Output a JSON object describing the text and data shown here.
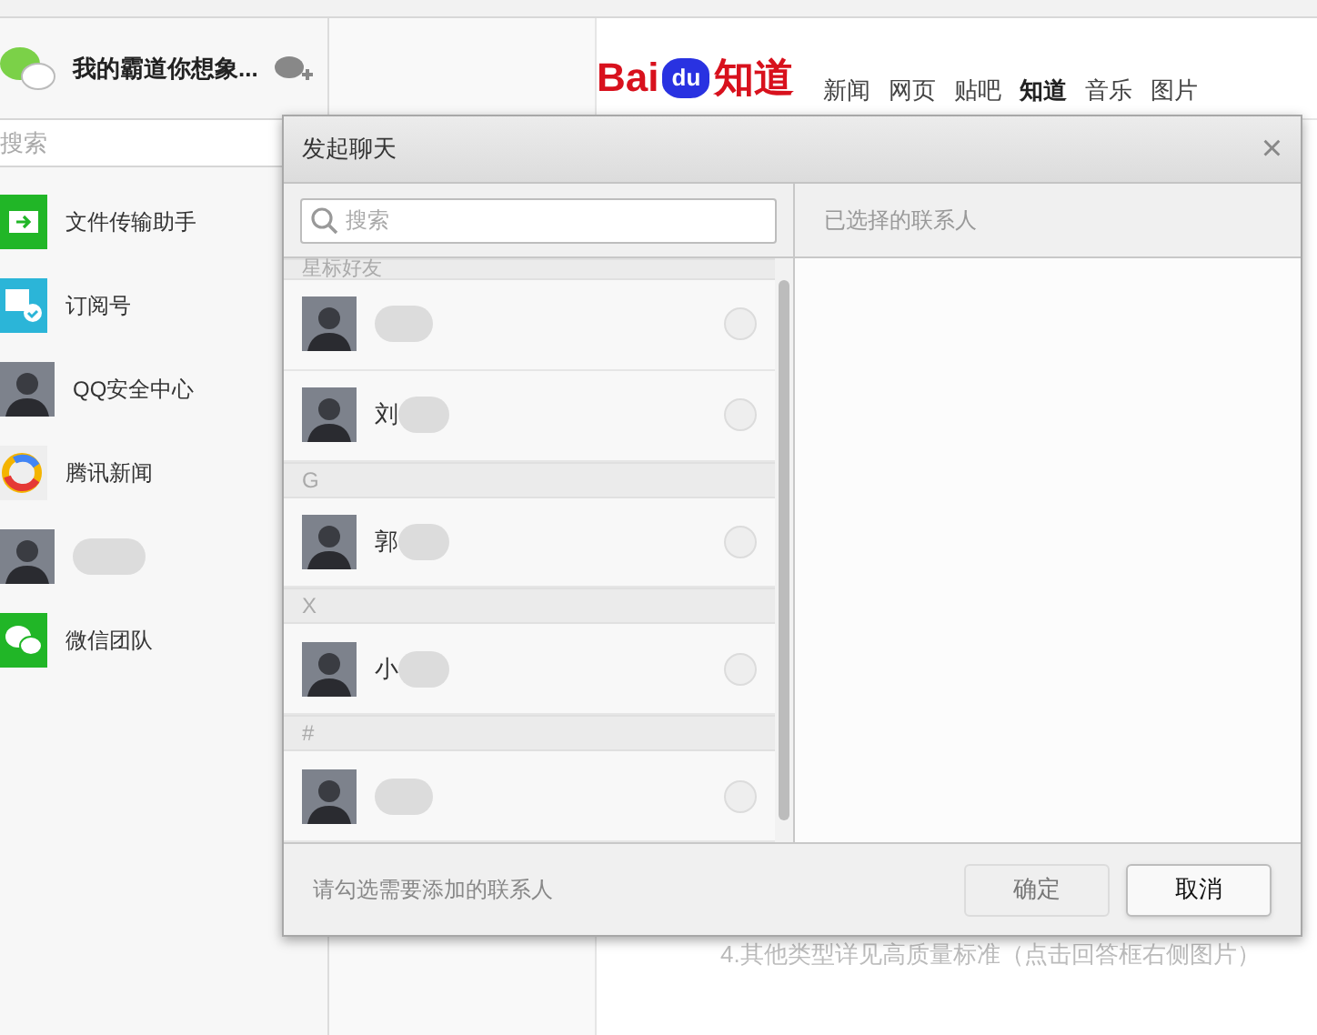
{
  "wechat": {
    "title": "我的霸道你想象...",
    "search": {
      "placeholder": "搜索"
    },
    "chats": [
      {
        "kind": "file",
        "name": "文件传输助手"
      },
      {
        "kind": "subscription",
        "name": "订阅号"
      },
      {
        "kind": "avatar",
        "name": "QQ安全中心"
      },
      {
        "kind": "news",
        "name": "腾讯新闻"
      },
      {
        "kind": "avatar"
      },
      {
        "kind": "team",
        "name": "微信团队"
      }
    ]
  },
  "browser": {
    "logo": {
      "left": "Bai",
      "mid": "du",
      "right": "知道"
    },
    "nav": [
      {
        "label": "新闻",
        "selected": false
      },
      {
        "label": "网页",
        "selected": false
      },
      {
        "label": "贴吧",
        "selected": false
      },
      {
        "label": "知道",
        "selected": true
      },
      {
        "label": "音乐",
        "selected": false
      },
      {
        "label": "图片",
        "selected": false
      }
    ],
    "note": "4.其他类型详见高质量标准（点击回答框右侧图片）"
  },
  "dialog": {
    "title": "发起聊天",
    "close": "×",
    "search": {
      "placeholder": "搜索"
    },
    "contacts": [
      {
        "kind": "header",
        "label": "星标好友"
      },
      {
        "kind": "contact",
        "selected": false
      },
      {
        "kind": "contact",
        "name": "刘",
        "selected": false
      },
      {
        "kind": "header",
        "label": "G"
      },
      {
        "kind": "contact",
        "name": "郭",
        "selected": false
      },
      {
        "kind": "header",
        "label": "X"
      },
      {
        "kind": "contact",
        "name": "小",
        "selected": false
      },
      {
        "kind": "header",
        "label": "#"
      },
      {
        "kind": "contact",
        "selected": false
      }
    ],
    "selected_header": "已选择的联系人",
    "hint": "请勾选需要添加的联系人",
    "buttons": [
      {
        "label": "确定",
        "disabled": true
      },
      {
        "label": "取消",
        "disabled": false
      }
    ]
  }
}
